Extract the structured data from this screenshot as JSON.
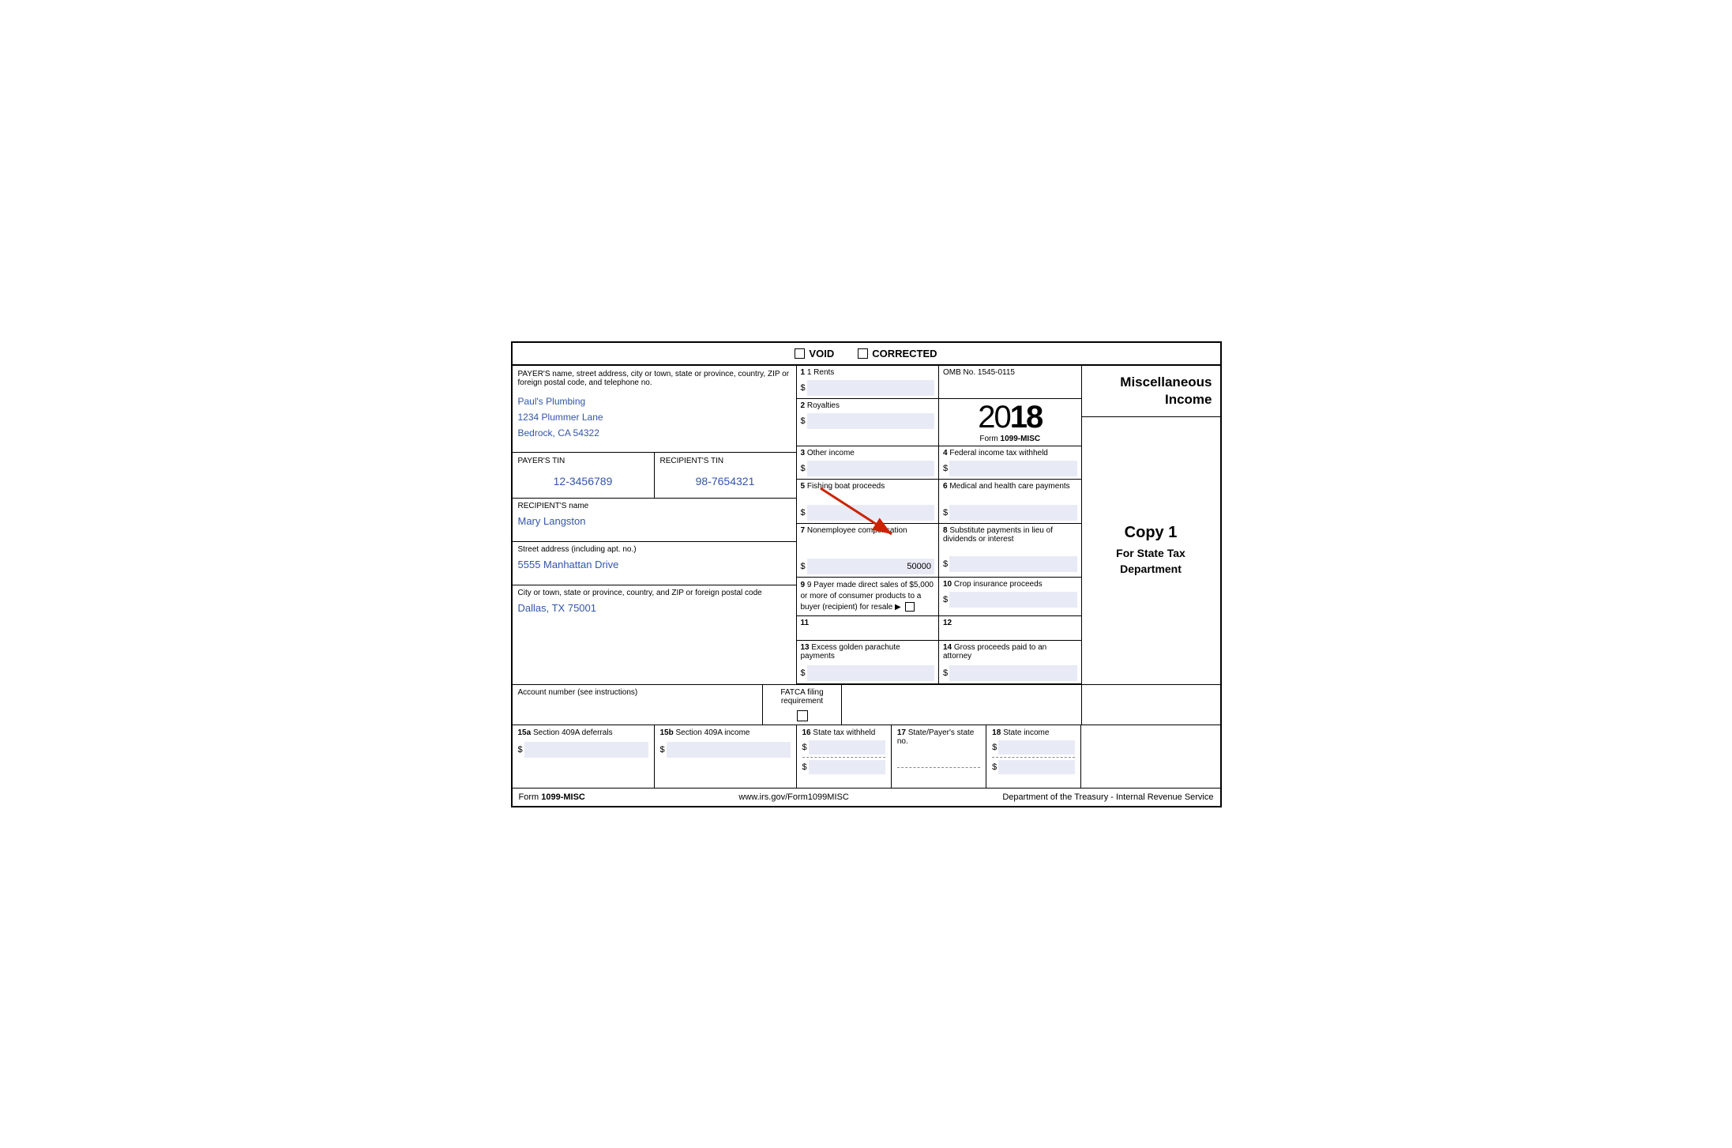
{
  "header": {
    "void_label": "VOID",
    "corrected_label": "CORRECTED"
  },
  "payer": {
    "field_label": "PAYER'S name, street address, city or town, state or province, country, ZIP or foreign postal code, and telephone no.",
    "name": "Paul's Plumbing",
    "address": "1234 Plummer Lane",
    "city_state": "Bedrock, CA 54322"
  },
  "year": {
    "light": "20",
    "bold": "18",
    "form_label": "Form",
    "form_number": "1099-MISC"
  },
  "title": {
    "line1": "Miscellaneous",
    "line2": "Income"
  },
  "copy": {
    "copy_label": "Copy 1",
    "subtitle": "For State Tax Department"
  },
  "boxes": {
    "b1_label": "1 Rents",
    "b1_value": "",
    "b2_label": "2 Royalties",
    "b2_value": "",
    "b3_label": "3 Other income",
    "b3_value": "",
    "b4_label": "4 Federal income tax withheld",
    "b4_value": "",
    "b5_label": "5 Fishing boat proceeds",
    "b5_value": "",
    "b6_label": "6 Medical and health care payments",
    "b6_value": "",
    "b7_label": "7 Nonemployee compensation",
    "b7_value": "50000",
    "b8_label": "8 Substitute payments in lieu of dividends or interest",
    "b8_value": "",
    "b9_label": "9 Payer made direct sales of $5,000 or more of consumer products to a buyer (recipient) for resale ▶",
    "b10_label": "10 Crop insurance proceeds",
    "b10_value": "",
    "b11_label": "11",
    "b12_label": "12",
    "b13_label": "13 Excess golden parachute payments",
    "b13_value": "",
    "b14_label": "14 Gross proceeds paid to an attorney",
    "b14_value": "",
    "b15a_label": "15a Section 409A deferrals",
    "b15a_value": "",
    "b15b_label": "15b Section 409A income",
    "b15b_value": "",
    "b16_label": "16 State tax withheld",
    "b16_value1": "",
    "b16_value2": "",
    "b17_label": "17 State/Payer's state no.",
    "b18_label": "18 State income",
    "b18_value1": "",
    "b18_value2": ""
  },
  "tin": {
    "payer_label": "PAYER'S TIN",
    "payer_value": "12-3456789",
    "recipient_label": "RECIPIENT'S TIN",
    "recipient_value": "98-7654321"
  },
  "recipient": {
    "name_label": "RECIPIENT'S name",
    "name_value": "Mary Langston",
    "street_label": "Street address (including apt. no.)",
    "street_value": "5555 Manhattan Drive",
    "city_label": "City or town, state or province, country, and ZIP or foreign postal code",
    "city_value": "Dallas, TX 75001"
  },
  "account": {
    "label": "Account number (see instructions)",
    "value": "",
    "fatca_label": "FATCA filing requirement"
  },
  "footer": {
    "form_label": "Form",
    "form_number": "1099-MISC",
    "website": "www.irs.gov/Form1099MISC",
    "dept": "Department of the Treasury - Internal Revenue Service"
  },
  "omb": {
    "label": "OMB No. 1545-0115"
  }
}
